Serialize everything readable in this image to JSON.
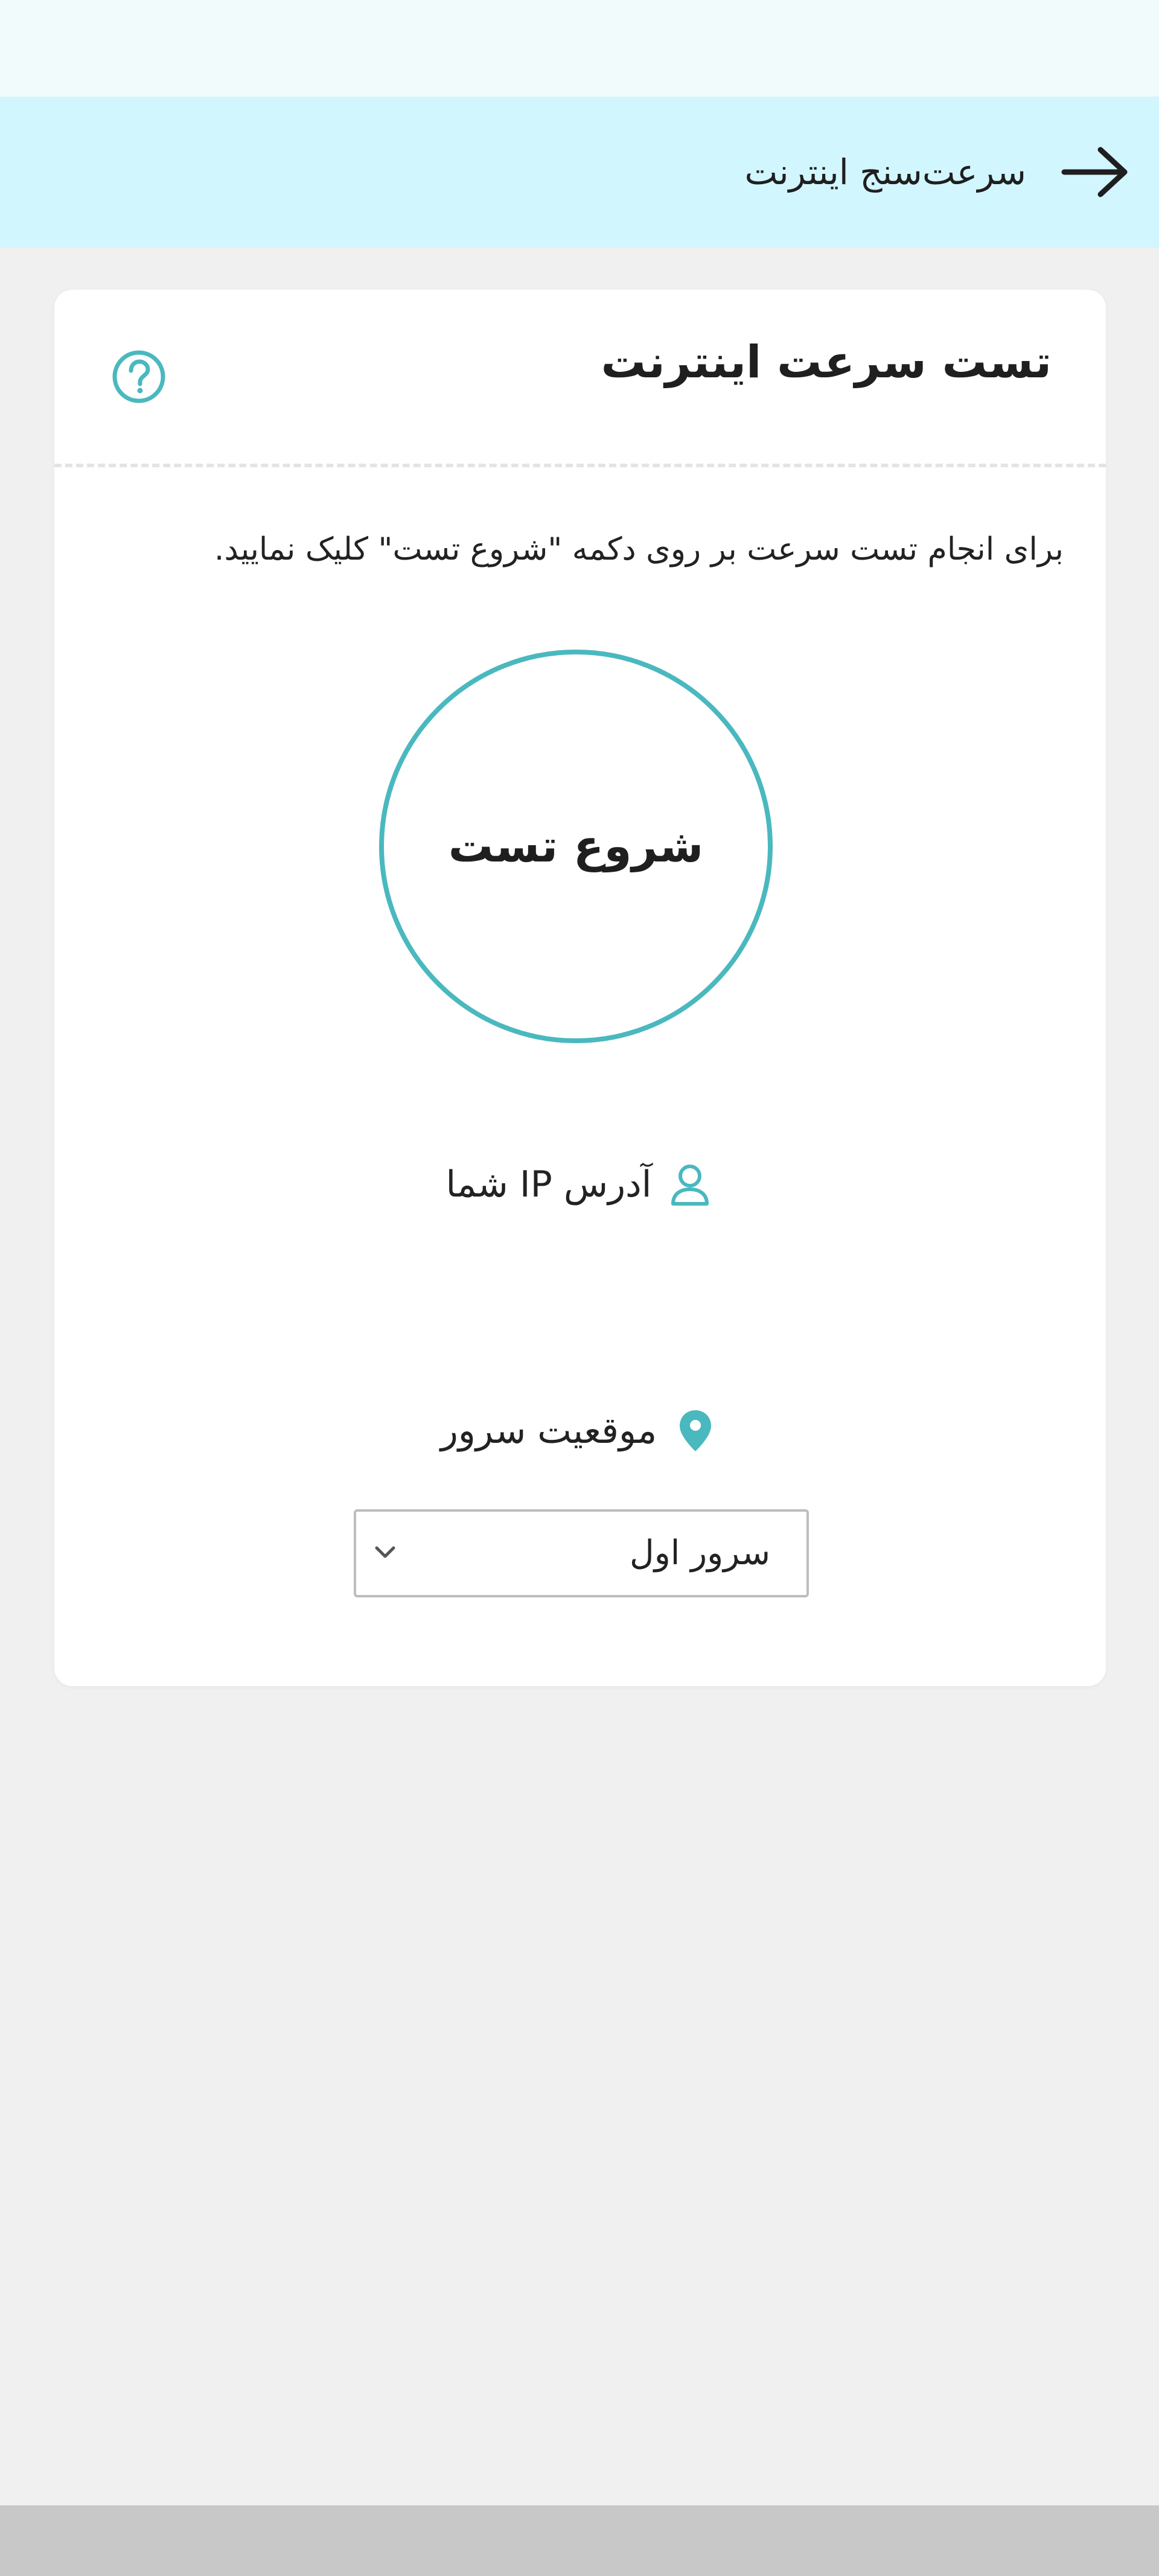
{
  "header": {
    "title": "سرعت‌سنج اینترنت",
    "back_icon": "arrow-right-icon"
  },
  "card": {
    "title": "تست سرعت اینترنت",
    "help_icon": "question-circle-icon",
    "instruction": "برای انجام تست سرعت بر روی دکمه \"شروع تست\" کلیک نمایید.",
    "start_button_label": "شروع تست",
    "ip_label": "آدرس IP شما",
    "ip_icon": "user-icon",
    "server_label": "موقعیت سرور",
    "server_icon": "map-pin-icon",
    "server_select": {
      "selected": "سرور اول"
    }
  },
  "colors": {
    "header_bg": "#d2f6fe",
    "accent": "#4ab8bf",
    "page_bg": "#f0f0f0",
    "card_bg": "#ffffff"
  }
}
